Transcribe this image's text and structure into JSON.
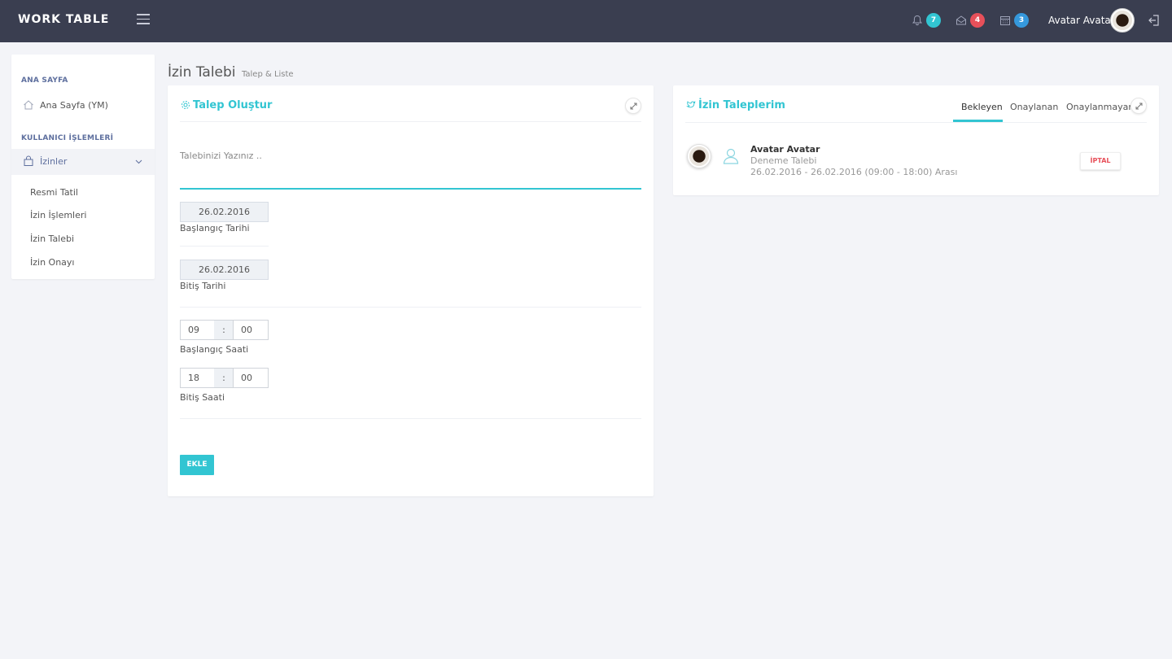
{
  "app": {
    "logo_text": "WORK TABLE"
  },
  "topbar": {
    "notifications": {
      "count": "7",
      "color": "#32c5d2"
    },
    "inbox": {
      "count": "4",
      "color": "#e7505a"
    },
    "calendar": {
      "count": "3",
      "color": "#3598dc"
    },
    "user_name": "Avatar Avatar"
  },
  "sidebar": {
    "section_home": "ANA SAYFA",
    "home_item": "Ana Sayfa (YM)",
    "section_user": "KULLANICI İŞLEMLERİ",
    "active_group": "İzinler",
    "sub_items": [
      "Resmi Tatil",
      "İzin İşlemleri",
      "İzin Talebi",
      "İzin Onayı"
    ]
  },
  "page": {
    "title": "İzin Talebi",
    "subtitle": "Talep & Liste"
  },
  "form": {
    "title": "Talep Oluştur",
    "textarea_placeholder": "Talebinizi Yazınız ..",
    "start_date_value": "26.02.2016",
    "start_date_label": "Başlangıç Tarihi",
    "end_date_value": "26.02.2016",
    "end_date_label": "Bitiş Tarihi",
    "start_hour": "09",
    "start_minute": "00",
    "start_time_label": "Başlangıç Saati",
    "end_hour": "18",
    "end_minute": "00",
    "end_time_label": "Bitiş Saati",
    "time_separator": ":",
    "submit_label": "EKLE"
  },
  "requests": {
    "title": "İzin Taleplerim",
    "tabs": [
      "Bekleyen",
      "Onaylanan",
      "Onaylanmayan"
    ],
    "active_tab": "Bekleyen",
    "items": [
      {
        "name": "Avatar Avatar",
        "description": "Deneme Talebi",
        "date_range": "26.02.2016 - 26.02.2016 (09:00 - 18:00) Arası",
        "cancel_label": "İPTAL"
      }
    ]
  },
  "colors": {
    "accent": "#32c5d2",
    "topbar": "#3a3e50",
    "danger": "#e7505a"
  }
}
